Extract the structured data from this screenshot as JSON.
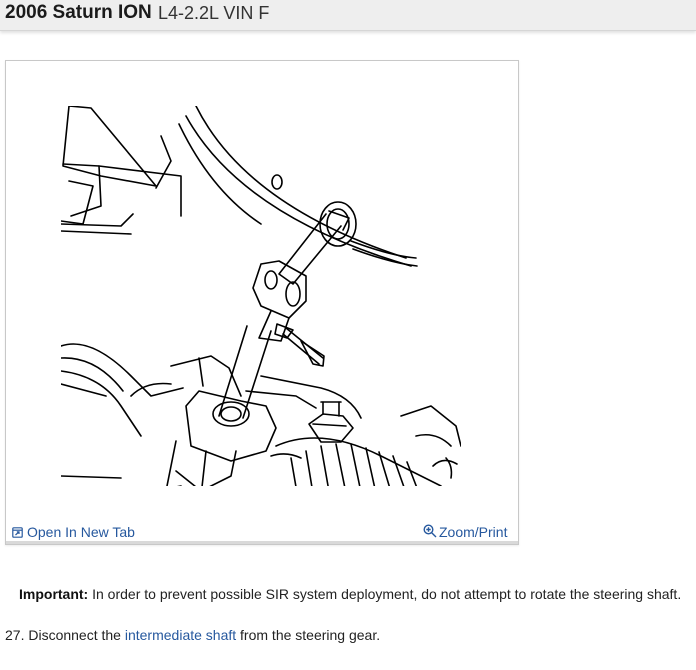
{
  "header": {
    "title": "2006 Saturn ION",
    "subtitle": "L4-2.2L VIN F"
  },
  "figure": {
    "icon": "steering-shaft-diagram",
    "open_label": "Open In New Tab",
    "zoom_label": "Zoom/Print"
  },
  "note": {
    "label": "Important:",
    "text": "In order to prevent possible SIR system deployment, do not attempt to rotate the steering shaft."
  },
  "step": {
    "prefix": "27. Disconnect the ",
    "link": "intermediate shaft",
    "suffix": " from the steering gear."
  },
  "colors": {
    "link": "#26589e",
    "header_bg": "#eeeeee"
  }
}
